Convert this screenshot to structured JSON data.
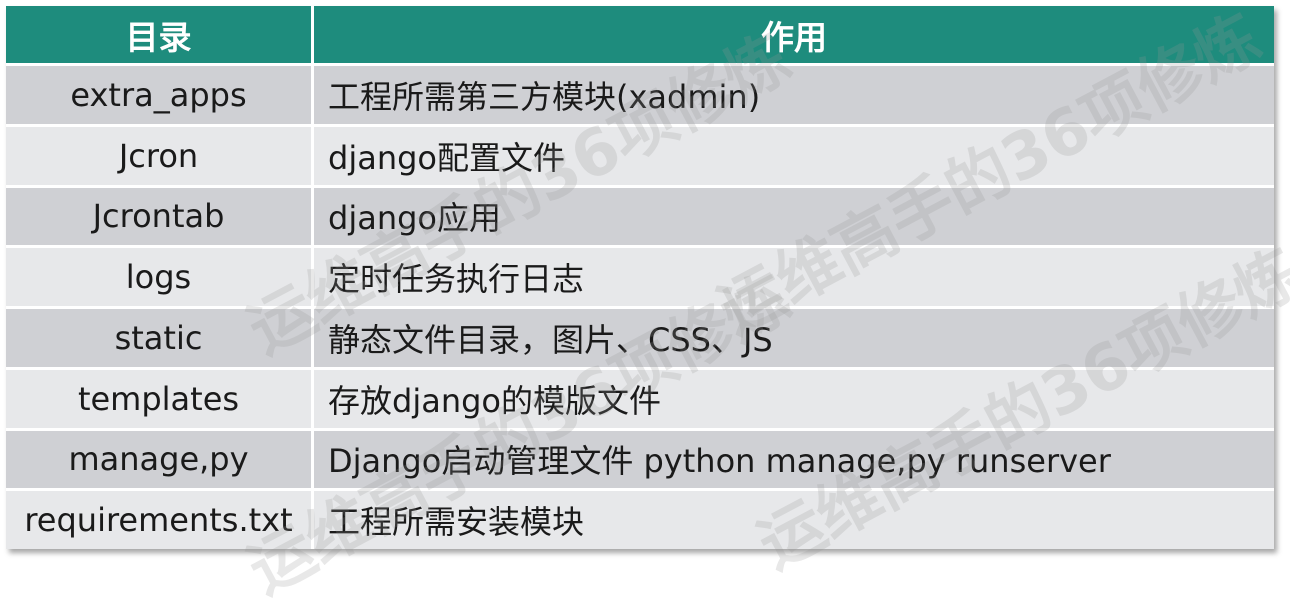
{
  "table": {
    "headers": [
      "目录",
      "作用"
    ],
    "rows": [
      {
        "name": "extra_apps",
        "desc": "工程所需第三方模块(xadmin)"
      },
      {
        "name": "Jcron",
        "desc": "django配置文件"
      },
      {
        "name": "Jcrontab",
        "desc": "django应用"
      },
      {
        "name": "logs",
        "desc": "定时任务执行日志"
      },
      {
        "name": "static",
        "desc": "静态文件目录，图片、CSS、JS"
      },
      {
        "name": "templates",
        "desc": "存放django的模版文件"
      },
      {
        "name": "manage,py",
        "desc": "Django启动管理文件 python manage,py runserver"
      },
      {
        "name": "requirements.txt",
        "desc": "工程所需安装模块"
      }
    ]
  },
  "watermark": {
    "text": "运维高手的36项修炼"
  },
  "colors": {
    "header_bg": "#1e8c7d",
    "row_dark": "#cfd0d4",
    "row_light": "#e7e8ea"
  }
}
